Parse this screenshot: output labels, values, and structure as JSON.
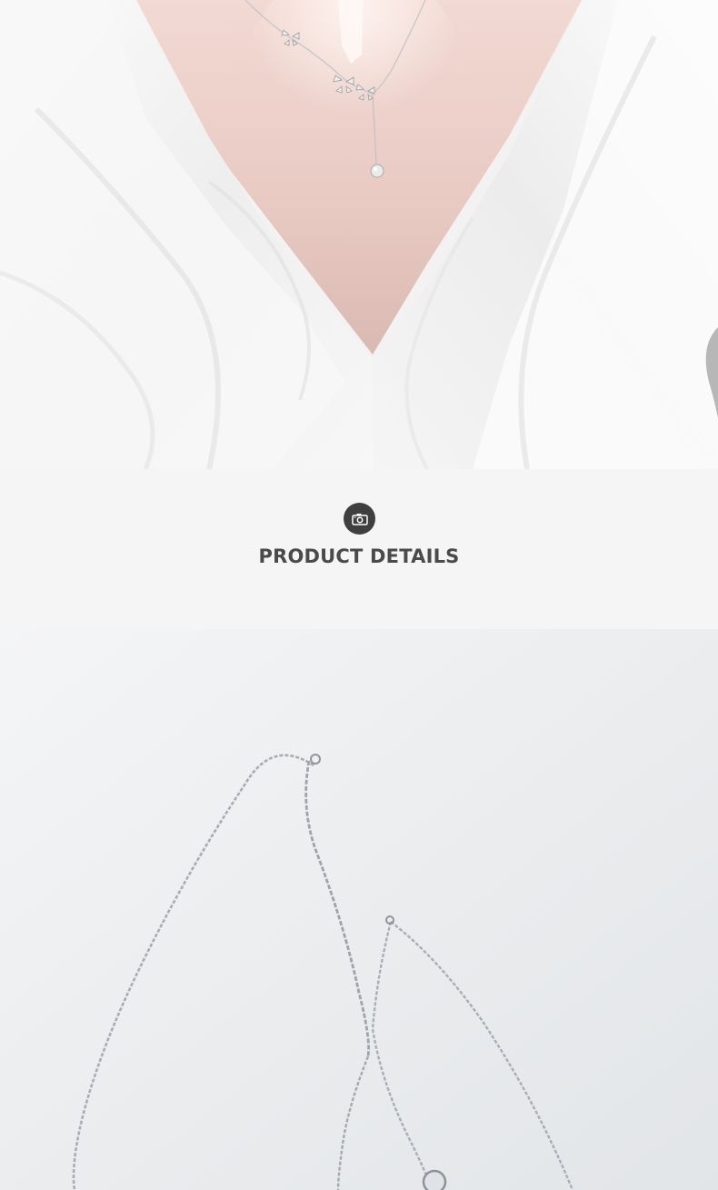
{
  "product_details": {
    "title": "PRODUCT DETAILS",
    "icon": "camera-icon"
  },
  "colors": {
    "band_background": "#f5f5f5",
    "title_text": "#4a4a4a",
    "icon_badge": "#3f3f3f"
  }
}
